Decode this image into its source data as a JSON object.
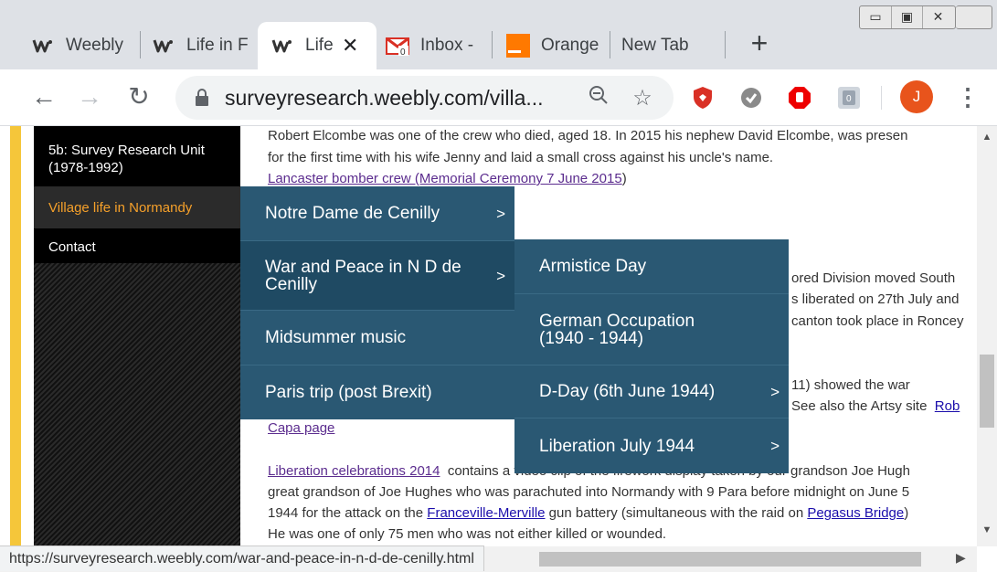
{
  "browser": {
    "tabs": [
      {
        "title": "Weebly",
        "icon": "weebly-logo"
      },
      {
        "title": "Life in F",
        "icon": "weebly-logo"
      },
      {
        "title": "Life",
        "icon": "weebly-logo",
        "active": true
      },
      {
        "title": "Inbox -",
        "icon": "gmail-icon"
      },
      {
        "title": "Orange",
        "icon": "orange-logo"
      },
      {
        "title": "New Tab",
        "icon": ""
      }
    ],
    "url": "surveyresearch.weebly.com/villa...",
    "avatar_letter": "J",
    "status_url": "https://surveyresearch.weebly.com/war-and-peace-in-n-d-de-cenilly.html"
  },
  "sidebar": {
    "items": [
      {
        "label": "5b: Survey Research Unit (1978-1992)"
      },
      {
        "label": "Village life in Normandy",
        "active": true
      },
      {
        "label": "Contact"
      }
    ]
  },
  "content": {
    "p1_line1": "Robert Elcombe was one of the crew who died, aged 18.  In 2015 his nephew  David Elcombe, was presen",
    "p1_line2": "for the first time with his wife Jenny and laid a small cross against his uncle's name.",
    "p1_link": "Lancaster bomber crew (Memorial Ceremony 7 June 2015",
    "p1_after": ")",
    "r1": "ored Division moved South",
    "r2": "s liberated on 27th July and",
    "r3": "canton took place in Roncey",
    "r4": "11) showed the war",
    "r5": "See also the Artsy site",
    "r5_link": "Rob",
    "capa_link": "Capa page",
    "p3_link": "Liberation celebrations 2014",
    "p3_line1_rest": "contains a video clip of the firework display taken by our grandson Joe Hugh",
    "p3_line2": "great grandson of Joe Hughes who was parachuted into Normandy with 9 Para before midnight on June 5",
    "p3_line3_a": "1944 for the attack on the ",
    "p3_line3_link1": "Franceville-Merville",
    "p3_line3_b": " gun battery (simultaneous with the raid on ",
    "p3_line3_link2": "Pegasus Bridge",
    "p3_line3_c": ")",
    "p3_line4": " He was one of only 75 men who was not either killed or wounded."
  },
  "menu_level1": [
    {
      "label": "Notre Dame de Cenilly",
      "has_sub": true
    },
    {
      "label": "War and Peace in N D de Cenilly",
      "has_sub": true,
      "hover": true
    },
    {
      "label": "Midsummer music",
      "has_sub": false
    },
    {
      "label": "Paris trip (post Brexit)",
      "has_sub": false
    }
  ],
  "menu_level2": [
    {
      "label": "Armistice Day",
      "has_sub": false
    },
    {
      "label": "German Occupation (1940 - 1944)",
      "has_sub": false
    },
    {
      "label": "D-Day (6th June 1944)",
      "has_sub": true
    },
    {
      "label": "Liberation July 1944",
      "has_sub": true
    }
  ],
  "colors": {
    "menu_bg": "#2a5873",
    "sidebar_active": "#f5a02a",
    "stripe": "#f5c63a"
  }
}
